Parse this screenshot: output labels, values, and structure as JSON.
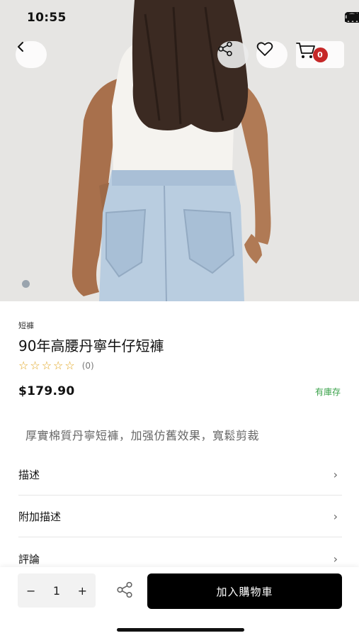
{
  "status": {
    "time": "10:55",
    "icons": [
      "signal-icon",
      "wifi-icon",
      "battery-icon"
    ]
  },
  "header": {
    "back_icon": "back-arrow-icon",
    "share_icon": "share-icon",
    "favorite_icon": "heart-icon",
    "cart_icon": "cart-icon",
    "cart_count": "0"
  },
  "gallery": {
    "current_page": 1
  },
  "product": {
    "category": "短褲",
    "title": "90年高腰丹寧牛仔短褲",
    "rating_stars": 0,
    "review_count": "(0)",
    "price": "$179.90",
    "stock_status": "有庫存",
    "short_description": "厚實棉質丹寧短褲，加强仿舊效果，寬鬆剪裁"
  },
  "sections": [
    {
      "label": "描述"
    },
    {
      "label": "附加描述"
    },
    {
      "label": "評論"
    }
  ],
  "purchase": {
    "quantity": "1",
    "minus_label": "−",
    "plus_label": "+",
    "add_to_cart_label": "加入購物車"
  },
  "colors": {
    "accent": "#000000",
    "badge": "#c62828",
    "star": "#e0a31a",
    "in_stock": "#3aa24a"
  }
}
